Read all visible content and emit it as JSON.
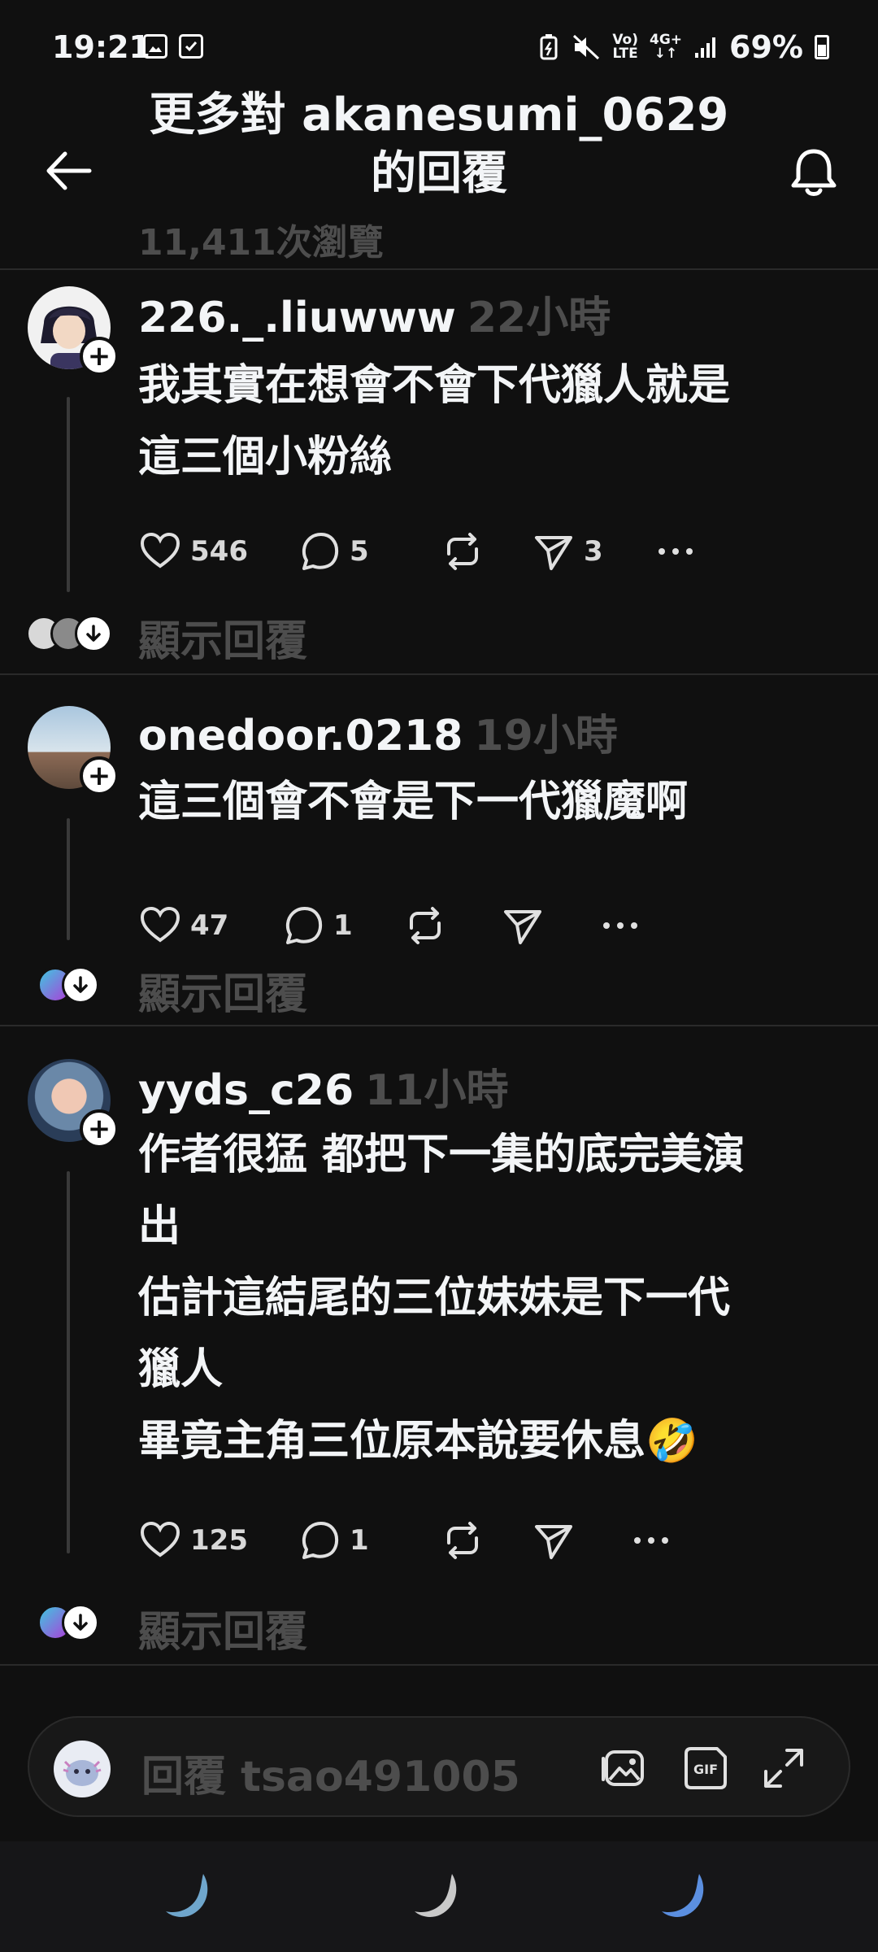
{
  "status_bar": {
    "time": "19:21",
    "signal_text_top": "Vo)",
    "signal_text_bottom": "LTE",
    "network_top": "4G+",
    "network_bottom": "↓↑",
    "battery": "69%"
  },
  "header": {
    "title_line1": "更多對 akanesumi_0629",
    "title_line2": "的回覆",
    "view_count": "11,411次瀏覽"
  },
  "posts": [
    {
      "username": "226._.liuwww",
      "time": "22小時",
      "body": "我其實在想會不會下代獵人就是\n這三個小粉絲",
      "likes": "546",
      "comments": "5",
      "shares": "3",
      "show_replies": "顯示回覆"
    },
    {
      "username": "onedoor.0218",
      "time": "19小時",
      "body": "這三個會不會是下一代獵魔啊",
      "likes": "47",
      "comments": "1",
      "shares": "",
      "show_replies": "顯示回覆"
    },
    {
      "username": "yyds_c26",
      "time": "11小時",
      "body": "作者很猛 都把下一集的底完美演\n出\n估計這結尾的三位妹妹是下一代\n獵人\n畢竟主角三位原本說要休息🤣",
      "likes": "125",
      "comments": "1",
      "shares": "",
      "show_replies": "顯示回覆"
    }
  ],
  "reply_bar": {
    "placeholder": "回覆 tsao491005"
  },
  "icons": {
    "back": "back-arrow-icon",
    "bell": "bell-icon",
    "like": "heart-icon",
    "comment": "comment-icon",
    "repost": "repost-icon",
    "share": "send-icon",
    "more": "more-icon",
    "image": "image-icon",
    "gif": "gif-icon",
    "expand": "expand-icon",
    "nav": "moon-icon"
  },
  "colors": {
    "background": "#101010",
    "text": "#f3f5f7",
    "muted": "#4d4d4d",
    "accent_moon": "#7ab4d8"
  }
}
